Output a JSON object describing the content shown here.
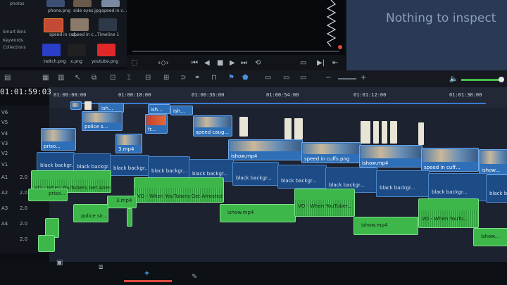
{
  "media_pool": {
    "bins": [
      "photos",
      "Smart Bins",
      "Keywords",
      "Collections"
    ],
    "thumbs": [
      {
        "label": "phone.png",
        "color": "#3b4f74"
      },
      {
        "label": "side eyes.jpg",
        "color": "#6b5a4a"
      },
      {
        "label": "speed in c...",
        "color": "#7a8aa0"
      },
      {
        "label": "speed in cuf...",
        "color": "#c44a36"
      },
      {
        "label": "speed in c...",
        "color": "#8a7a6a"
      },
      {
        "label": "Timeline 1",
        "color": "#2d3848"
      },
      {
        "label": "twitch.png",
        "color": "#2a3ec8"
      },
      {
        "label": "x.png",
        "color": "#202020"
      },
      {
        "label": "youtube.png",
        "color": "#e0282a"
      }
    ]
  },
  "inspector": {
    "empty_text": "Nothing to inspect"
  },
  "timeline": {
    "timecode": "01:01:59:03",
    "ruler": [
      "01:00:00:00",
      "01:00:18:00",
      "01:00:36:00",
      "01:00:54:00",
      "01:01:12:00",
      "01:01:30:00"
    ],
    "track_labels": [
      "V6",
      "V5",
      "V4",
      "V3",
      "V2",
      "V1",
      "A1",
      "A2",
      "A3",
      "A4"
    ],
    "video_clips": [
      {
        "label": "ish..."
      },
      {
        "label": "police s..."
      },
      {
        "label": "ish..."
      },
      {
        "label": "ish..."
      },
      {
        "label": "fr..."
      },
      {
        "label": "speed caug..."
      },
      {
        "label": "priso..."
      },
      {
        "label": "3.mp4"
      },
      {
        "label": "ishow.mp4"
      },
      {
        "label": "speed in cuffs.png"
      },
      {
        "label": "ishow.mp4"
      },
      {
        "label": "speed in cuff..."
      },
      {
        "label": "ishow..."
      }
    ],
    "title_clips": [
      {
        "label": "black backgr..."
      },
      {
        "label": "black backgr..."
      },
      {
        "label": "black backgr..."
      },
      {
        "label": "black backgr..."
      },
      {
        "label": "black backgr..."
      },
      {
        "label": "black backgr..."
      },
      {
        "label": "black backgr..."
      },
      {
        "label": "black backgr..."
      },
      {
        "label": "black backgr..."
      },
      {
        "label": "black backgr..."
      },
      {
        "label": "black backgr..."
      },
      {
        "label": "black backgr..."
      }
    ],
    "audio_clips": [
      {
        "label": "VO - When YouTubers Get Arrested.mp3"
      },
      {
        "label": "VO - When YouTubers Get Arrested.mp3"
      },
      {
        "label": "priso..."
      },
      {
        "label": "3.mp4"
      },
      {
        "label": "police sir..."
      },
      {
        "label": "ishow.mp4"
      },
      {
        "label": "VO - When YouTuber..."
      },
      {
        "label": "ishow.mp4"
      },
      {
        "label": "VO - When YouTu..."
      },
      {
        "label": "ishow..."
      }
    ],
    "audio_levels": [
      "2.0",
      "2.0",
      "2.0",
      "2.0",
      "2.0"
    ]
  }
}
